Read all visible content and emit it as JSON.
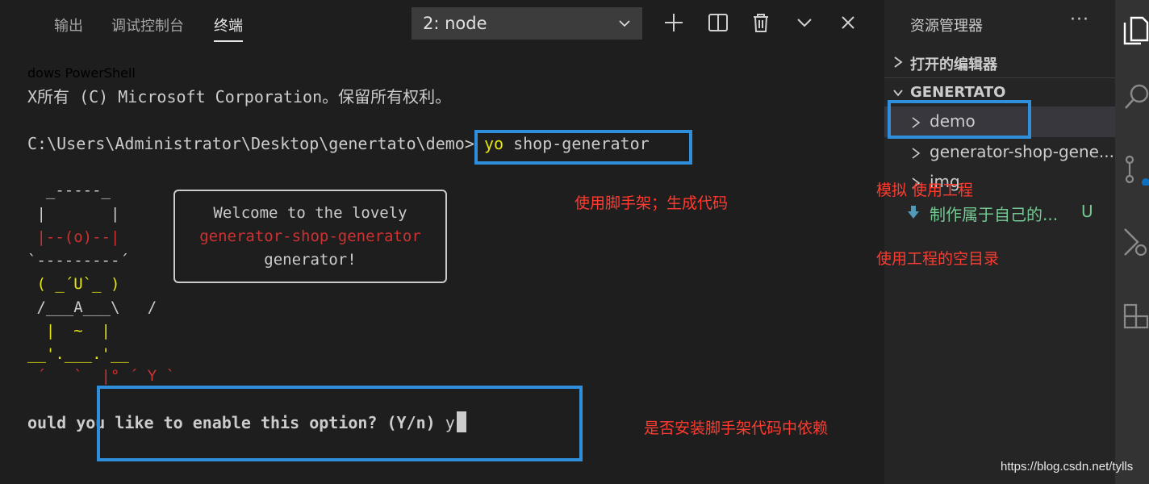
{
  "panel": {
    "tabs": [
      {
        "label": "输出"
      },
      {
        "label": "调试控制台"
      },
      {
        "label": "终端"
      }
    ],
    "active_tab": "终端",
    "terminal_select": "2: node"
  },
  "terminal": {
    "lines": {
      "l1": "dows PowerShell",
      "l2": "X所有 (C) Microsoft Corporation。保留所有权利。",
      "prompt": "C:\\Users\\Administrator\\Desktop\\genertato\\demo> ",
      "cmd_yo": "yo",
      "cmd_rest": " shop-generator",
      "question": "ould you like to enable this option? (Y/n) ",
      "answer": "y"
    },
    "ascii": {
      "a1": "  _-----_",
      "a2": " |       |",
      "a3": " |--(o)--|",
      "a4": "`---------´",
      "a5": " ( _´U`_ )",
      "a6": " /___A___\\   /",
      "a7": "  |  ~  |",
      "a8": "__'.___.'__",
      "a9": " ´   `  |° ´ Y `"
    },
    "bubble": {
      "line1": "Welcome to the lovely",
      "line2": "generator-shop-generator",
      "line3": "generator!"
    }
  },
  "annotations": {
    "scaffold": "使用脚手架；生成代码",
    "install_deps": "是否安装脚手架代码中依赖",
    "simulate": "模拟 使用工程",
    "empty_dir": "使用工程的空目录"
  },
  "explorer": {
    "title": "资源管理器",
    "more": "···",
    "open_editors": "打开的编辑器",
    "project": "GENERTATO",
    "items": [
      {
        "label": "demo"
      },
      {
        "label": "generator-shop-gene..."
      },
      {
        "label": "img"
      },
      {
        "label": "制作属于自己的...",
        "badge": "U"
      }
    ]
  },
  "watermark": "https://blog.csdn.net/tylls",
  "colors": {
    "annotation_red": "#ff3b30",
    "annotation_blue": "#2f8fdd",
    "terminal_yellow": "#e5e510",
    "terminal_red": "#cd3131",
    "untracked_green": "#73c991"
  }
}
